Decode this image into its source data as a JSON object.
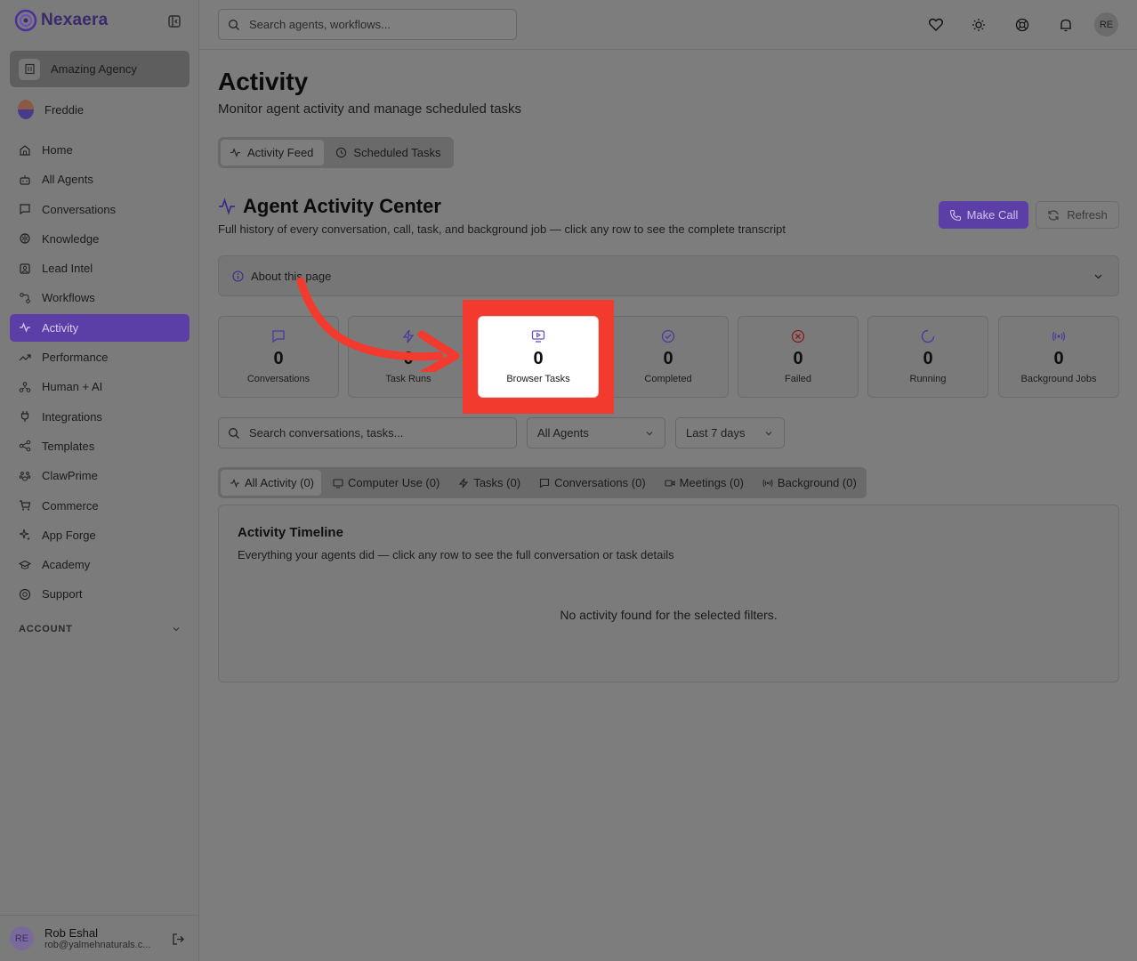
{
  "brand": {
    "name": "Nexaera",
    "accent": "#5b3fa6",
    "highlight": "#f23a2e"
  },
  "sidebar": {
    "agency": "Amazing Agency",
    "user": "Freddie",
    "items": [
      {
        "label": "Home",
        "icon": "home-icon"
      },
      {
        "label": "All Agents",
        "icon": "bot-icon"
      },
      {
        "label": "Conversations",
        "icon": "message-icon"
      },
      {
        "label": "Knowledge",
        "icon": "brain-icon"
      },
      {
        "label": "Lead Intel",
        "icon": "contact-icon"
      },
      {
        "label": "Workflows",
        "icon": "workflow-icon"
      },
      {
        "label": "Activity",
        "icon": "activity-icon",
        "active": true
      },
      {
        "label": "Performance",
        "icon": "trending-icon"
      },
      {
        "label": "Human + AI",
        "icon": "people-icon"
      },
      {
        "label": "Integrations",
        "icon": "plug-icon"
      },
      {
        "label": "Templates",
        "icon": "share-icon"
      },
      {
        "label": "ClawPrime",
        "icon": "paw-icon"
      },
      {
        "label": "Commerce",
        "icon": "cart-icon"
      },
      {
        "label": "App Forge",
        "icon": "sparkles-icon"
      },
      {
        "label": "Academy",
        "icon": "graduation-icon"
      },
      {
        "label": "Support",
        "icon": "lifebuoy-icon"
      }
    ],
    "account_label": "ACCOUNT",
    "footer": {
      "initials": "RE",
      "name": "Rob Eshal",
      "email": "rob@yalmehnaturals.c..."
    }
  },
  "topbar": {
    "search_placeholder": "Search agents, workflows...",
    "avatar_initials": "RE"
  },
  "page": {
    "title": "Activity",
    "subtitle": "Monitor agent activity and manage scheduled tasks",
    "tabs": [
      "Activity Feed",
      "Scheduled Tasks"
    ],
    "section_title": "Agent Activity Center",
    "section_subtitle": "Full history of every conversation, call, task, and background job — click any row to see the complete transcript",
    "make_call": "Make Call",
    "refresh": "Refresh",
    "about": "About this page"
  },
  "stats": [
    {
      "value": "0",
      "label": "Conversations",
      "icon": "message-icon",
      "color": "#4b38a0"
    },
    {
      "value": "0",
      "label": "Task Runs",
      "icon": "zap-icon",
      "color": "#4b38a0"
    },
    {
      "value": "0",
      "label": "Browser Tasks",
      "icon": "monitor-play-icon",
      "color": "#6a4fc2"
    },
    {
      "value": "0",
      "label": "Completed",
      "icon": "check-circle-icon",
      "color": "#4b38a0"
    },
    {
      "value": "0",
      "label": "Failed",
      "icon": "x-circle-icon",
      "color": "#8a1a1a"
    },
    {
      "value": "0",
      "label": "Running",
      "icon": "loader-icon",
      "color": "#4b38a0"
    },
    {
      "value": "0",
      "label": "Background Jobs",
      "icon": "radio-icon",
      "color": "#4b38a0"
    }
  ],
  "filters": {
    "search_placeholder": "Search conversations, tasks...",
    "agent": "All Agents",
    "range": "Last 7 days"
  },
  "activity_tabs": [
    {
      "label": "All Activity (0)",
      "icon": "activity-icon"
    },
    {
      "label": "Computer Use (0)",
      "icon": "monitor-icon"
    },
    {
      "label": "Tasks (0)",
      "icon": "zap-icon"
    },
    {
      "label": "Conversations (0)",
      "icon": "message-icon"
    },
    {
      "label": "Meetings (0)",
      "icon": "video-icon"
    },
    {
      "label": "Background (0)",
      "icon": "radio-icon"
    }
  ],
  "timeline": {
    "title": "Activity Timeline",
    "subtitle": "Everything your agents did — click any row to see the full conversation or task details",
    "empty": "No activity found for the selected filters."
  }
}
